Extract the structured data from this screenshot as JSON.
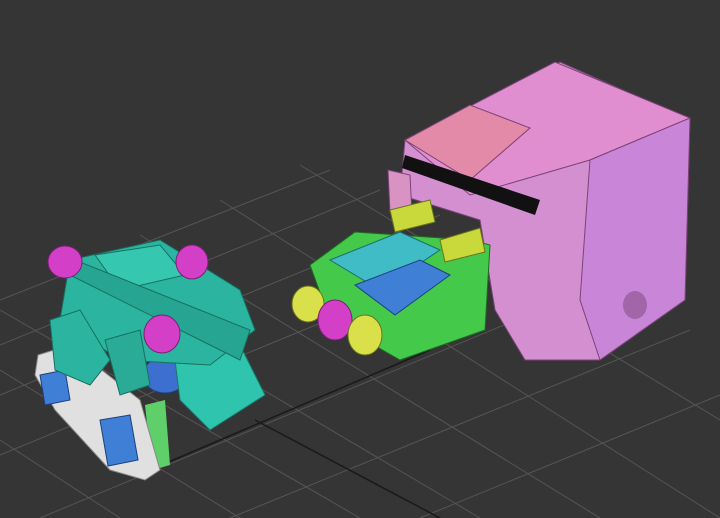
{
  "viewport": {
    "background": "#353535",
    "grid_color": "#555555",
    "axis_color": "#1a1a1a"
  },
  "objects": [
    {
      "name": "teal-robot-part",
      "color": "#2bb5a0"
    },
    {
      "name": "magenta-wheel",
      "color": "#d43fc7"
    },
    {
      "name": "white-blue-bracket",
      "color": "#e8e8e8"
    },
    {
      "name": "blue-part",
      "color": "#3f7fd6"
    },
    {
      "name": "green-cab-part",
      "color": "#44c94a"
    },
    {
      "name": "lime-handle",
      "color": "#c9d93c"
    },
    {
      "name": "pink-truck-cab",
      "color": "#d993d1"
    }
  ]
}
